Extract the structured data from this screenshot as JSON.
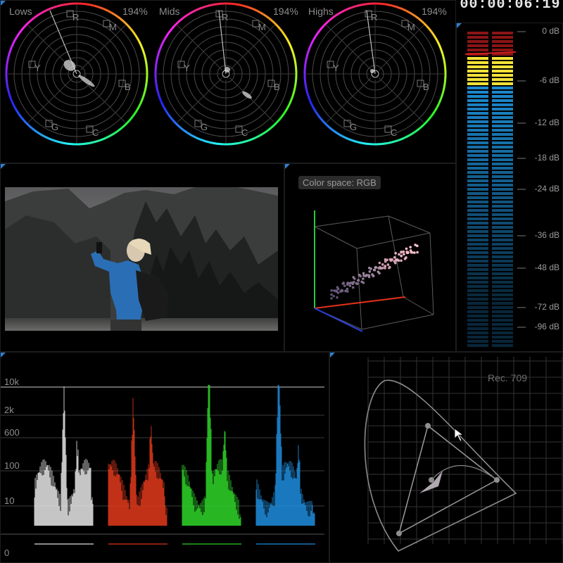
{
  "timecode": "00:00:06:19",
  "scopes": {
    "wheels": [
      {
        "id": "lows",
        "title": "Lows",
        "percent": "194%"
      },
      {
        "id": "mids",
        "title": "Mids",
        "percent": "194%"
      },
      {
        "id": "highs",
        "title": "Highs",
        "percent": "194%"
      }
    ],
    "wheel_targets": [
      "R",
      "M",
      "B",
      "C",
      "G",
      "Y"
    ]
  },
  "color_space": {
    "label": "Color space: RGB"
  },
  "audio_meter": {
    "db_labels": [
      "0 dB",
      "-6 dB",
      "-12 dB",
      "-18 dB",
      "-24 dB",
      "-36 dB",
      "-48 dB",
      "-72 dB",
      "-96 dB"
    ]
  },
  "histogram": {
    "y_labels": [
      "10k",
      "2k",
      "600",
      "100",
      "10",
      "0"
    ],
    "channels": [
      "white",
      "red",
      "green",
      "blue"
    ]
  },
  "cie": {
    "label": "Rec. 709"
  },
  "colors": {
    "accent": "#2f7fd0",
    "meter_red": "#8a1414",
    "meter_yellow": "#f2e238",
    "meter_blue": "#1d8ad0",
    "hist_white": "#e8e8e8",
    "hist_red": "#e23a1c",
    "hist_green": "#2fd62a",
    "hist_blue": "#1f8fe0"
  }
}
